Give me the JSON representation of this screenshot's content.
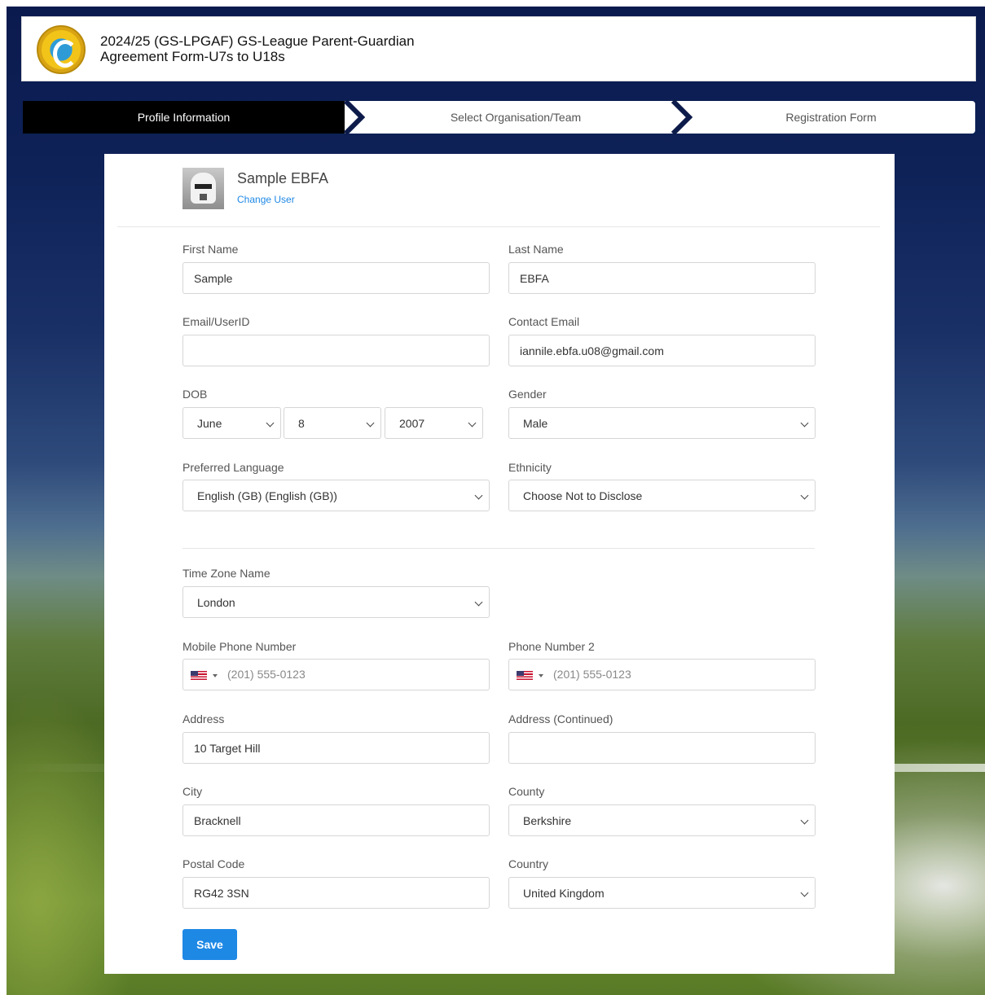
{
  "header": {
    "title_line1": "2024/25 (GS-LPGAF) GS-League Parent-Guardian",
    "title_line2": "Agreement Form-U7s to U18s",
    "logo_icon": "league-crest-logo"
  },
  "wizard": {
    "steps": [
      {
        "label": "Profile Information",
        "active": true
      },
      {
        "label": "Select Organisation/Team",
        "active": false
      },
      {
        "label": "Registration Form",
        "active": false
      }
    ]
  },
  "profile": {
    "name": "Sample EBFA",
    "change_user": "Change User",
    "avatar_icon": "user-avatar"
  },
  "form": {
    "first_name": {
      "label": "First Name",
      "value": "Sample"
    },
    "last_name": {
      "label": "Last Name",
      "value": "EBFA"
    },
    "email_userid": {
      "label": "Email/UserID",
      "value": ""
    },
    "contact_email": {
      "label": "Contact Email",
      "value": "iannile.ebfa.u08@gmail.com"
    },
    "dob": {
      "label": "DOB",
      "month": "June",
      "day": "8",
      "year": "2007"
    },
    "gender": {
      "label": "Gender",
      "value": "Male"
    },
    "preferred_language": {
      "label": "Preferred Language",
      "value": "English (GB) (English (GB))"
    },
    "ethnicity": {
      "label": "Ethnicity",
      "value": "Choose Not to Disclose"
    },
    "time_zone": {
      "label": "Time Zone Name",
      "value": "London"
    },
    "mobile_phone": {
      "label": "Mobile Phone Number",
      "placeholder": "(201) 555-0123",
      "flag": "us-flag-icon"
    },
    "phone2": {
      "label": "Phone Number 2",
      "placeholder": "(201) 555-0123",
      "flag": "us-flag-icon"
    },
    "address": {
      "label": "Address",
      "value": "10 Target Hill"
    },
    "address2": {
      "label": "Address (Continued)",
      "value": ""
    },
    "city": {
      "label": "City",
      "value": "Bracknell"
    },
    "county": {
      "label": "County",
      "value": "Berkshire"
    },
    "postal_code": {
      "label": "Postal Code",
      "value": "RG42 3SN"
    },
    "country": {
      "label": "Country",
      "value": "United Kingdom"
    },
    "save_label": "Save"
  },
  "colors": {
    "accent": "#1e88e5",
    "active_step_bg": "#000000",
    "card_bg": "#ffffff"
  }
}
